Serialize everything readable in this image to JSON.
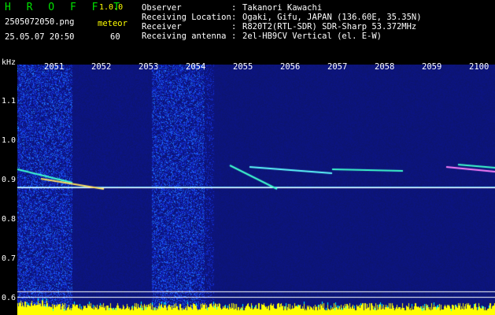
{
  "header": {
    "title": "H R O F F T",
    "version": "1.0.0",
    "filename": "2505072050.png",
    "datetime": "25.05.07 20:50",
    "meteor_label": "meteor",
    "meteor_count": "60"
  },
  "info": {
    "observer_key": "Observer",
    "observer_val": "Takanori Kawachi",
    "location_key": "Receiving Location",
    "location_val": "Ogaki, Gifu, JAPAN (136.60E, 35.35N)",
    "receiver_key": "Receiver",
    "receiver_val": "R820T2(RTL-SDR) SDR-Sharp 53.372MHz",
    "antenna_key": "Receiving antenna",
    "antenna_val": "2el-HB9CV Vertical (el. E-W)",
    "colon": ":"
  },
  "chart_data": {
    "type": "heatmap",
    "ylabel": "kHz",
    "y_ticks": [
      "1.1",
      "1.0",
      "0.9",
      "0.8",
      "0.7",
      "0.6"
    ],
    "x_ticks": [
      "2051",
      "2052",
      "2053",
      "2054",
      "2055",
      "2056",
      "2057",
      "2058",
      "2059",
      "2100"
    ],
    "carrier_khz": 0.88
  },
  "colors": {
    "background": "#000000",
    "title": "#00e000",
    "accent": "#ffff00",
    "text": "#ffffff",
    "spectrum_base": "#101a8a"
  }
}
